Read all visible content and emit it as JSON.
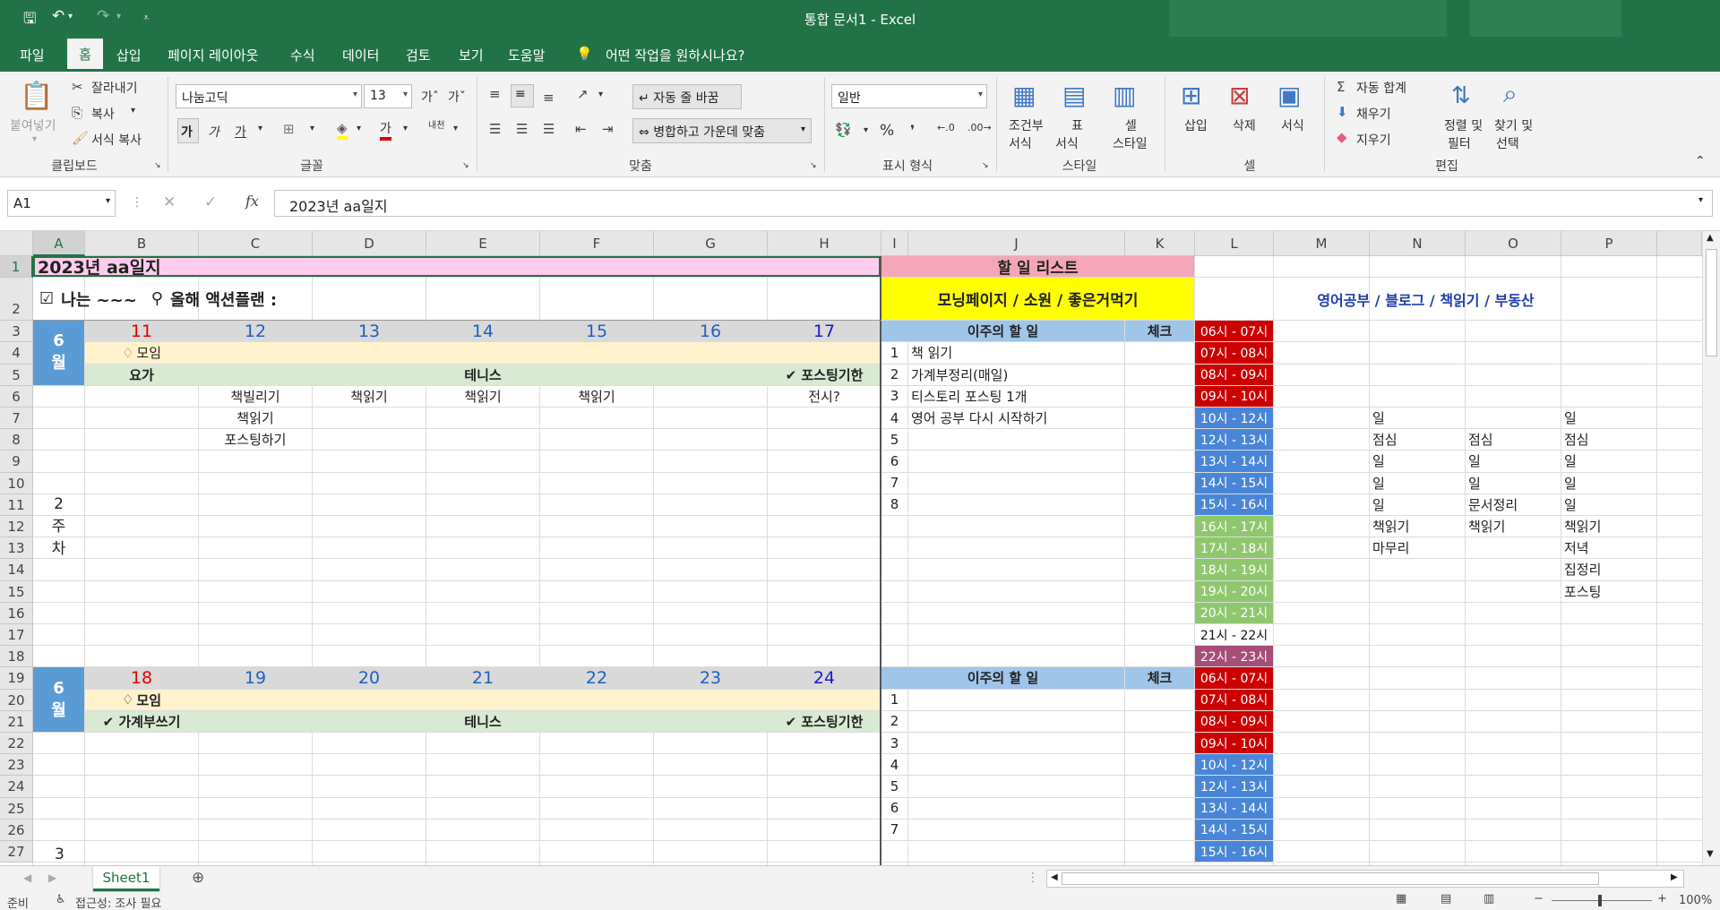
{
  "titlebar": {
    "title": "통합 문서1  -  Excel",
    "save_icon": "save-icon",
    "undo_icon": "undo-icon",
    "redo_icon": "redo-icon"
  },
  "menu": {
    "tabs": [
      "파일",
      "홈",
      "삽입",
      "페이지 레이아웃",
      "수식",
      "데이터",
      "검토",
      "보기",
      "도움말"
    ],
    "tell_me": "어떤 작업을 원하시나요?"
  },
  "ribbon": {
    "clipboard": {
      "paste": "붙여넣기",
      "cut": "잘라내기",
      "copy": "복사",
      "format_painter": "서식 복사",
      "label": "클립보드"
    },
    "font": {
      "name": "나눔고딕",
      "size": "13",
      "bold": "가",
      "italic": "가",
      "underline": "가",
      "label": "글꼴",
      "fontcolor": "가",
      "phonetic": "내천"
    },
    "alignment": {
      "wrap": "자동 줄 바꿈",
      "merge": "병합하고 가운데 맞춤",
      "label": "맞춤"
    },
    "number": {
      "format": "일반",
      "percent": "%",
      "label": "표시 형식"
    },
    "styles": {
      "cond": "조건부\n서식",
      "table": "표\n서식",
      "cell": "셀\n스타일",
      "cond_l1": "조건부",
      "cond_l2": "서식",
      "table_l1": "표",
      "table_l2": "서식",
      "cell_l1": "셀",
      "cell_l2": "스타일",
      "label": "스타일"
    },
    "cells": {
      "insert": "삽입",
      "delete": "삭제",
      "format": "서식",
      "label": "셀"
    },
    "editing": {
      "autosum": "자동 합계",
      "fill": "채우기",
      "clear": "지우기",
      "sort_l1": "정렬 및",
      "sort_l2": "필터",
      "find_l1": "찾기 및",
      "find_l2": "선택",
      "label": "편집"
    }
  },
  "formula_bar": {
    "name_box": "A1",
    "formula": "2023년 aa일지"
  },
  "columns": [
    "A",
    "B",
    "C",
    "D",
    "E",
    "F",
    "G",
    "H",
    "I",
    "J",
    "K",
    "L",
    "M",
    "N",
    "O",
    "P"
  ],
  "rows": [
    "1",
    "2",
    "3",
    "4",
    "5",
    "6",
    "7",
    "8",
    "9",
    "10",
    "11",
    "12",
    "13",
    "14",
    "15",
    "16",
    "17",
    "18",
    "19",
    "20",
    "21",
    "22",
    "23",
    "24",
    "25",
    "26",
    "27"
  ],
  "sheet": {
    "title": "2023년 aa일지",
    "todo_header": "할 일 리스트",
    "row2_left": "나는 ~~~",
    "row2_action": "올해 액션플랜 :",
    "row2_center": "모닝페이지 / 소원 / 좋은거먹기",
    "row2_right": "영어공부 / 블로그 / 책읽기 / 부동산",
    "month": "6\n월",
    "month_char1": "6",
    "month_char2": "월",
    "week2": [
      "2",
      "주",
      "차"
    ],
    "week3": "3",
    "week1_dates": [
      "11",
      "12",
      "13",
      "14",
      "15",
      "16",
      "17"
    ],
    "week2_dates": [
      "18",
      "19",
      "20",
      "21",
      "22",
      "23",
      "24"
    ],
    "meeting": "모임",
    "yoga": "요가",
    "tennis": "테니스",
    "posting_deadline": "✔ 포스팅기한",
    "household_book": "✔ 가계부쓰기",
    "week1_tasks": {
      "c6": "책빌리기",
      "d6": "책읽기",
      "e6": "책읽기",
      "f6": "책읽기",
      "h6": "전시?",
      "c7": "책읽기",
      "c8": "포스팅하기"
    },
    "this_week_todo": "이주의 할 일",
    "check": "체크",
    "todo_items": [
      {
        "n": "1",
        "t": "책 읽기"
      },
      {
        "n": "2",
        "t": "가계부정리(매일)"
      },
      {
        "n": "3",
        "t": "티스토리 포스팅 1개"
      },
      {
        "n": "4",
        "t": "영어 공부 다시 시작하기"
      },
      {
        "n": "5",
        "t": ""
      },
      {
        "n": "6",
        "t": ""
      },
      {
        "n": "7",
        "t": ""
      },
      {
        "n": "8",
        "t": ""
      }
    ],
    "todo_numbers_week2": [
      "1",
      "2",
      "3",
      "4",
      "5",
      "6",
      "7"
    ],
    "time_slots": [
      "06시 - 07시",
      "07시 - 08시",
      "08시 - 09시",
      "09시 - 10시",
      "10시 - 12시",
      "12시 - 13시",
      "13시 - 14시",
      "14시 - 15시",
      "15시 - 16시",
      "16시 - 17시",
      "17시 - 18시",
      "18시 - 19시",
      "19시 - 20시",
      "20시 - 21시",
      "21시 - 22시",
      "22시 - 23시"
    ],
    "time_slots_week2": [
      "06시 - 07시",
      "07시 - 08시",
      "08시 - 09시",
      "09시 - 10시",
      "10시 - 12시",
      "12시 - 13시",
      "13시 - 14시",
      "14시 - 15시",
      "15시 - 16시"
    ],
    "schedule": {
      "n7": "일",
      "p7": "일",
      "n8": "점심",
      "o8": "점심",
      "p8": "점심",
      "n9": "일",
      "o9": "일",
      "p9": "일",
      "n10": "일",
      "o10": "일",
      "p10": "일",
      "n11": "일",
      "o11": "문서정리",
      "p11": "일",
      "n12": "책읽기",
      "o12": "책읽기",
      "p12": "책읽기",
      "n13": "마무리",
      "p13": "저녁",
      "p14": "집정리",
      "p15": "포스팅"
    }
  },
  "sheet_tab": "Sheet1",
  "status": {
    "ready": "준비",
    "accessibility": "접근성: 조사 필요",
    "zoom": "100%"
  },
  "colors": {
    "excel_green": "#217346",
    "pink": "#ffccee",
    "yellow": "#ffff00",
    "blue_month": "#5b9bd5",
    "time_red": "#cc0000",
    "time_blue": "#4a86d8",
    "time_green": "#8fc76e",
    "time_purple": "#a64d79",
    "todo_header_pink": "#f4a6b8",
    "light_blue": "#9fc5e8",
    "orange_light": "#fff2cc",
    "green_light": "#d9ead3",
    "gray_hdr": "#d9d9d9"
  }
}
